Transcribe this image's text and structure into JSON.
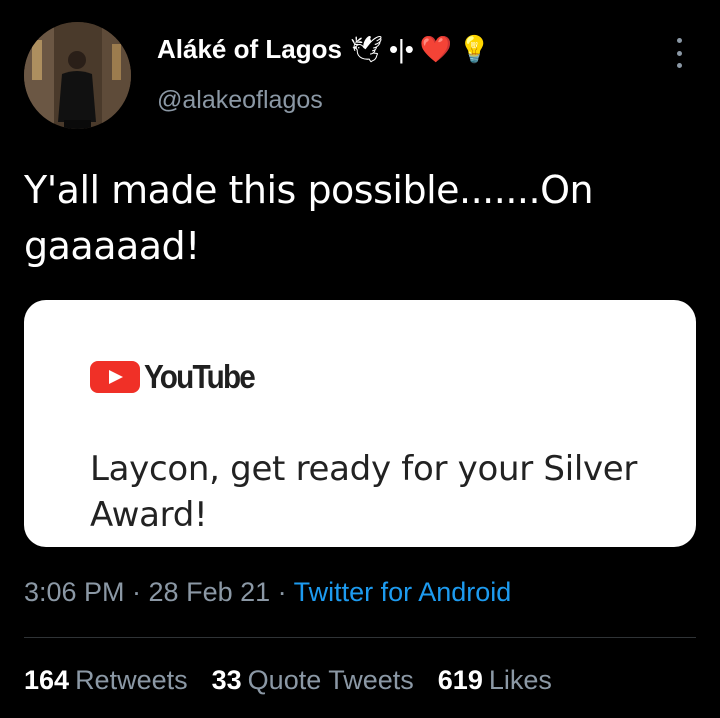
{
  "author": {
    "display_name": "Aláké of Lagos",
    "name_emoji": [
      "🕊",
      "•|•",
      "❤️",
      "💡"
    ],
    "handle": "@alakeoflagos"
  },
  "tweet": {
    "text": "Y'all made this possible.......On gaaaaad!",
    "timestamp": "3:06 PM · 28 Feb 21 · ",
    "source": "Twitter for Android"
  },
  "card": {
    "brand": "YouTube",
    "message": "Laycon, get ready for your Silver Award!"
  },
  "stats": {
    "retweets_count": "164",
    "retweets_label": "Retweets",
    "quotes_count": "33",
    "quotes_label": "Quote Tweets",
    "likes_count": "619",
    "likes_label": "Likes"
  },
  "icons": {
    "more": "more-vertical-icon",
    "youtube": "youtube-play-icon"
  },
  "colors": {
    "background": "#000000",
    "secondary_text": "#8b98a5",
    "link": "#1d9bf0",
    "youtube_red": "#f03027"
  }
}
